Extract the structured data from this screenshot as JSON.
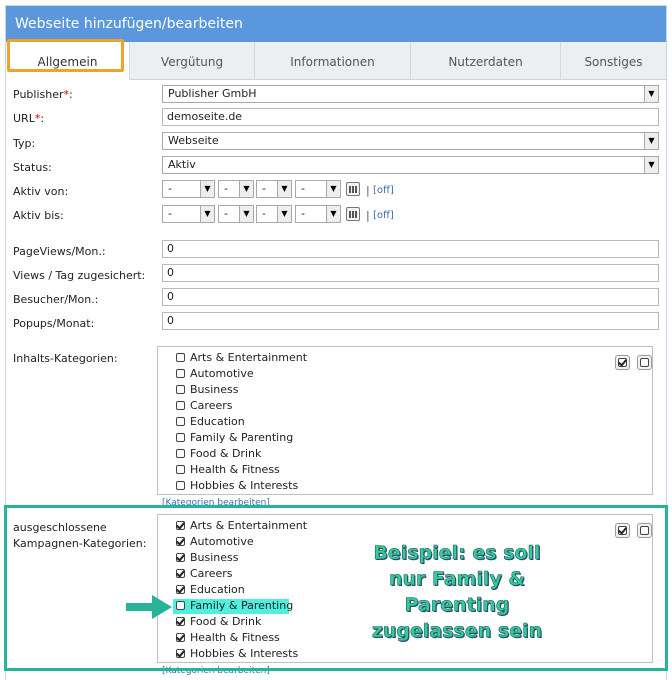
{
  "window": {
    "title": "Webseite hinzufügen/bearbeiten"
  },
  "tabs": [
    {
      "label": "Allgemein"
    },
    {
      "label": "Vergütung"
    },
    {
      "label": "Informationen"
    },
    {
      "label": "Nutzerdaten"
    },
    {
      "label": "Sonstiges"
    }
  ],
  "form": {
    "publisher": {
      "label": "Publisher",
      "required": "*",
      "suffix": ":",
      "value": "Publisher GmbH"
    },
    "url": {
      "label": "URL",
      "required": "*",
      "suffix": ":",
      "value": "demoseite.de"
    },
    "typ": {
      "label": "Typ:",
      "value": "Webseite"
    },
    "status": {
      "label": "Status:",
      "value": "Aktiv"
    },
    "aktiv_von": {
      "label": "Aktiv von:",
      "d": "-",
      "m": "-",
      "y": "-",
      "h": "-",
      "off": "[off]",
      "sep": "|"
    },
    "aktiv_bis": {
      "label": "Aktiv bis:",
      "d": "-",
      "m": "-",
      "y": "-",
      "h": "-",
      "off": "[off]",
      "sep": "|"
    },
    "pageviews": {
      "label": "PageViews/Mon.:",
      "value": "0"
    },
    "views_tag": {
      "label": "Views / Tag zugesichert:",
      "value": "0"
    },
    "besucher": {
      "label": "Besucher/Mon.:",
      "value": "0"
    },
    "popups": {
      "label": "Popups/Monat:",
      "value": "0"
    }
  },
  "inhalts_kategorien": {
    "label": "Inhalts-Kategorien:",
    "edit_link": "[Kategorien bearbeiten]",
    "items": [
      {
        "label": "Arts & Entertainment",
        "checked": false
      },
      {
        "label": "Automotive",
        "checked": false
      },
      {
        "label": "Business",
        "checked": false
      },
      {
        "label": "Careers",
        "checked": false
      },
      {
        "label": "Education",
        "checked": false
      },
      {
        "label": "Family & Parenting",
        "checked": false
      },
      {
        "label": "Food & Drink",
        "checked": false
      },
      {
        "label": "Health & Fitness",
        "checked": false
      },
      {
        "label": "Hobbies & Interests",
        "checked": false
      }
    ]
  },
  "ausgeschlossene_kategorien": {
    "label_line1": "ausgeschlossene",
    "label_line2": "Kampagnen-Kategorien:",
    "edit_link": "[Kategorien bearbeiten]",
    "items": [
      {
        "label": "Arts & Entertainment",
        "checked": true
      },
      {
        "label": "Automotive",
        "checked": true
      },
      {
        "label": "Business",
        "checked": true
      },
      {
        "label": "Careers",
        "checked": true
      },
      {
        "label": "Education",
        "checked": true
      },
      {
        "label": "Family & Parenting",
        "checked": false
      },
      {
        "label": "Food & Drink",
        "checked": true
      },
      {
        "label": "Health & Fitness",
        "checked": true
      },
      {
        "label": "Hobbies & Interests",
        "checked": true
      }
    ]
  },
  "annotation": {
    "line1": "Beispiel: es soll",
    "line2": "nur Family &",
    "line3": "Parenting",
    "line4": "zugelassen sein"
  },
  "colors": {
    "titlebar": "#5a97dc",
    "highlight_tab": "#f0a22a",
    "annotation_frame": "#27b39a",
    "annotation_text": "#2fd18b",
    "row_highlight": "#4ff0df"
  }
}
